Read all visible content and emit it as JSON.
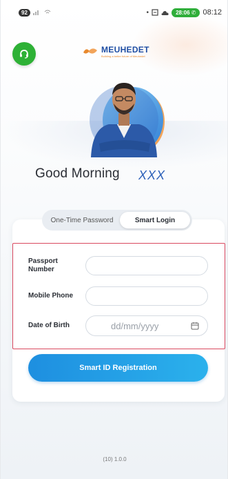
{
  "status_bar": {
    "battery": "92",
    "call_timer": "28:06",
    "time": "08:12"
  },
  "brand": {
    "name": "MEUHEDET",
    "tagline": "Building a better future of Meuhedet",
    "primary_color": "#1f4ea3",
    "accent_color": "#e8892e"
  },
  "header": {
    "support_icon": "headset-icon",
    "greeting": "Good Morning",
    "user_name": "XXX"
  },
  "tabs": [
    {
      "label": "One-Time Password",
      "selected": false
    },
    {
      "label": "Smart Login",
      "selected": true
    }
  ],
  "form": {
    "passport_label_line1": "Passport",
    "passport_label_line2": "Number",
    "passport_value": "",
    "mobile_label": "Mobile Phone",
    "mobile_value": "",
    "dob_label": "Date of Birth",
    "dob_placeholder": "dd/mm/yyyy",
    "highlight_color": "#d9485f"
  },
  "actions": {
    "register_label": "Smart ID Registration",
    "button_color": "#1e8fe0"
  },
  "footer": {
    "version": "(10) 1.0.0"
  }
}
